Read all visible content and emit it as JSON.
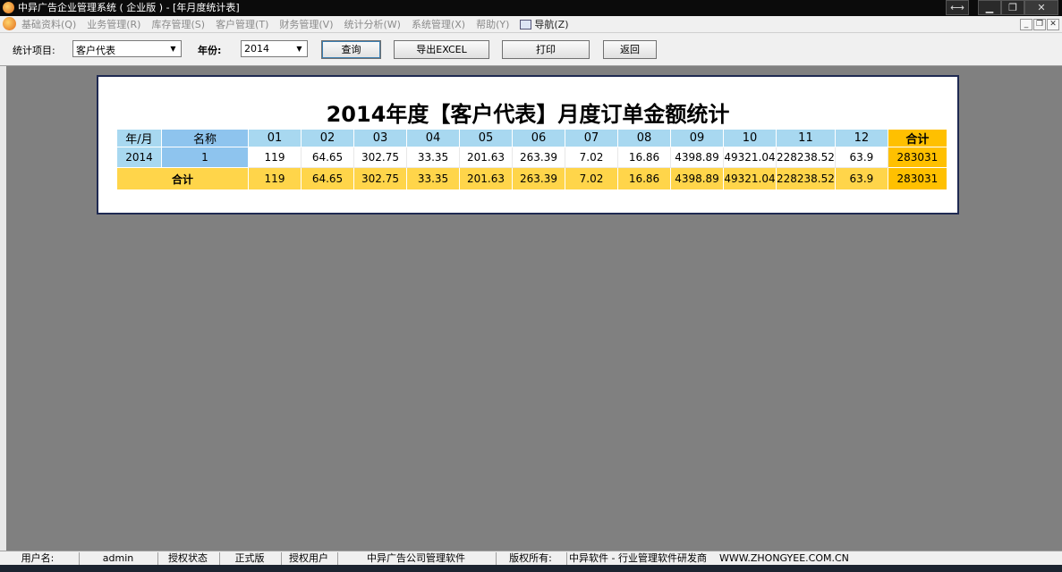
{
  "window": {
    "title": "中异广告企业管理系统 ( 企业版 ) - [年月度统计表]"
  },
  "menu": {
    "items": [
      "基础资料(Q)",
      "业务管理(R)",
      "库存管理(S)",
      "客户管理(T)",
      "财务管理(V)",
      "统计分析(W)",
      "系统管理(X)",
      "帮助(Y)"
    ],
    "nav": "导航(Z)"
  },
  "toolbar": {
    "item_label": "统计项目:",
    "item_value": "客户代表",
    "year_label": "年份:",
    "year_value": "2014",
    "query": "查询",
    "export": "导出EXCEL",
    "print": "打印",
    "back": "返回"
  },
  "report": {
    "title": "2014年度【客户代表】月度订单金额统计",
    "headers": [
      "年/月",
      "名称",
      "01",
      "02",
      "03",
      "04",
      "05",
      "06",
      "07",
      "08",
      "09",
      "10",
      "11",
      "12",
      "合计"
    ],
    "row": {
      "year": "2014",
      "name": "1",
      "values": [
        "119",
        "64.65",
        "302.75",
        "33.35",
        "201.63",
        "263.39",
        "7.02",
        "16.86",
        "4398.89",
        "49321.04",
        "228238.52",
        "63.9"
      ],
      "sum": "283031"
    },
    "total": {
      "label": "合计",
      "values": [
        "119",
        "64.65",
        "302.75",
        "33.35",
        "201.63",
        "263.39",
        "7.02",
        "16.86",
        "4398.89",
        "49321.04",
        "228238.52",
        "63.9"
      ],
      "sum": "283031"
    }
  },
  "status": {
    "user_label": "用户名:",
    "user_value": "admin",
    "auth_label": "授权状态",
    "auth_value": "正式版",
    "licensee_label": "授权用户",
    "licensee_value": "中异广告公司管理软件",
    "copyright_label": "版权所有:",
    "copyright_value": "中异软件 - 行业管理软件研发商",
    "website": "WWW.ZHONGYEE.COM.CN"
  }
}
